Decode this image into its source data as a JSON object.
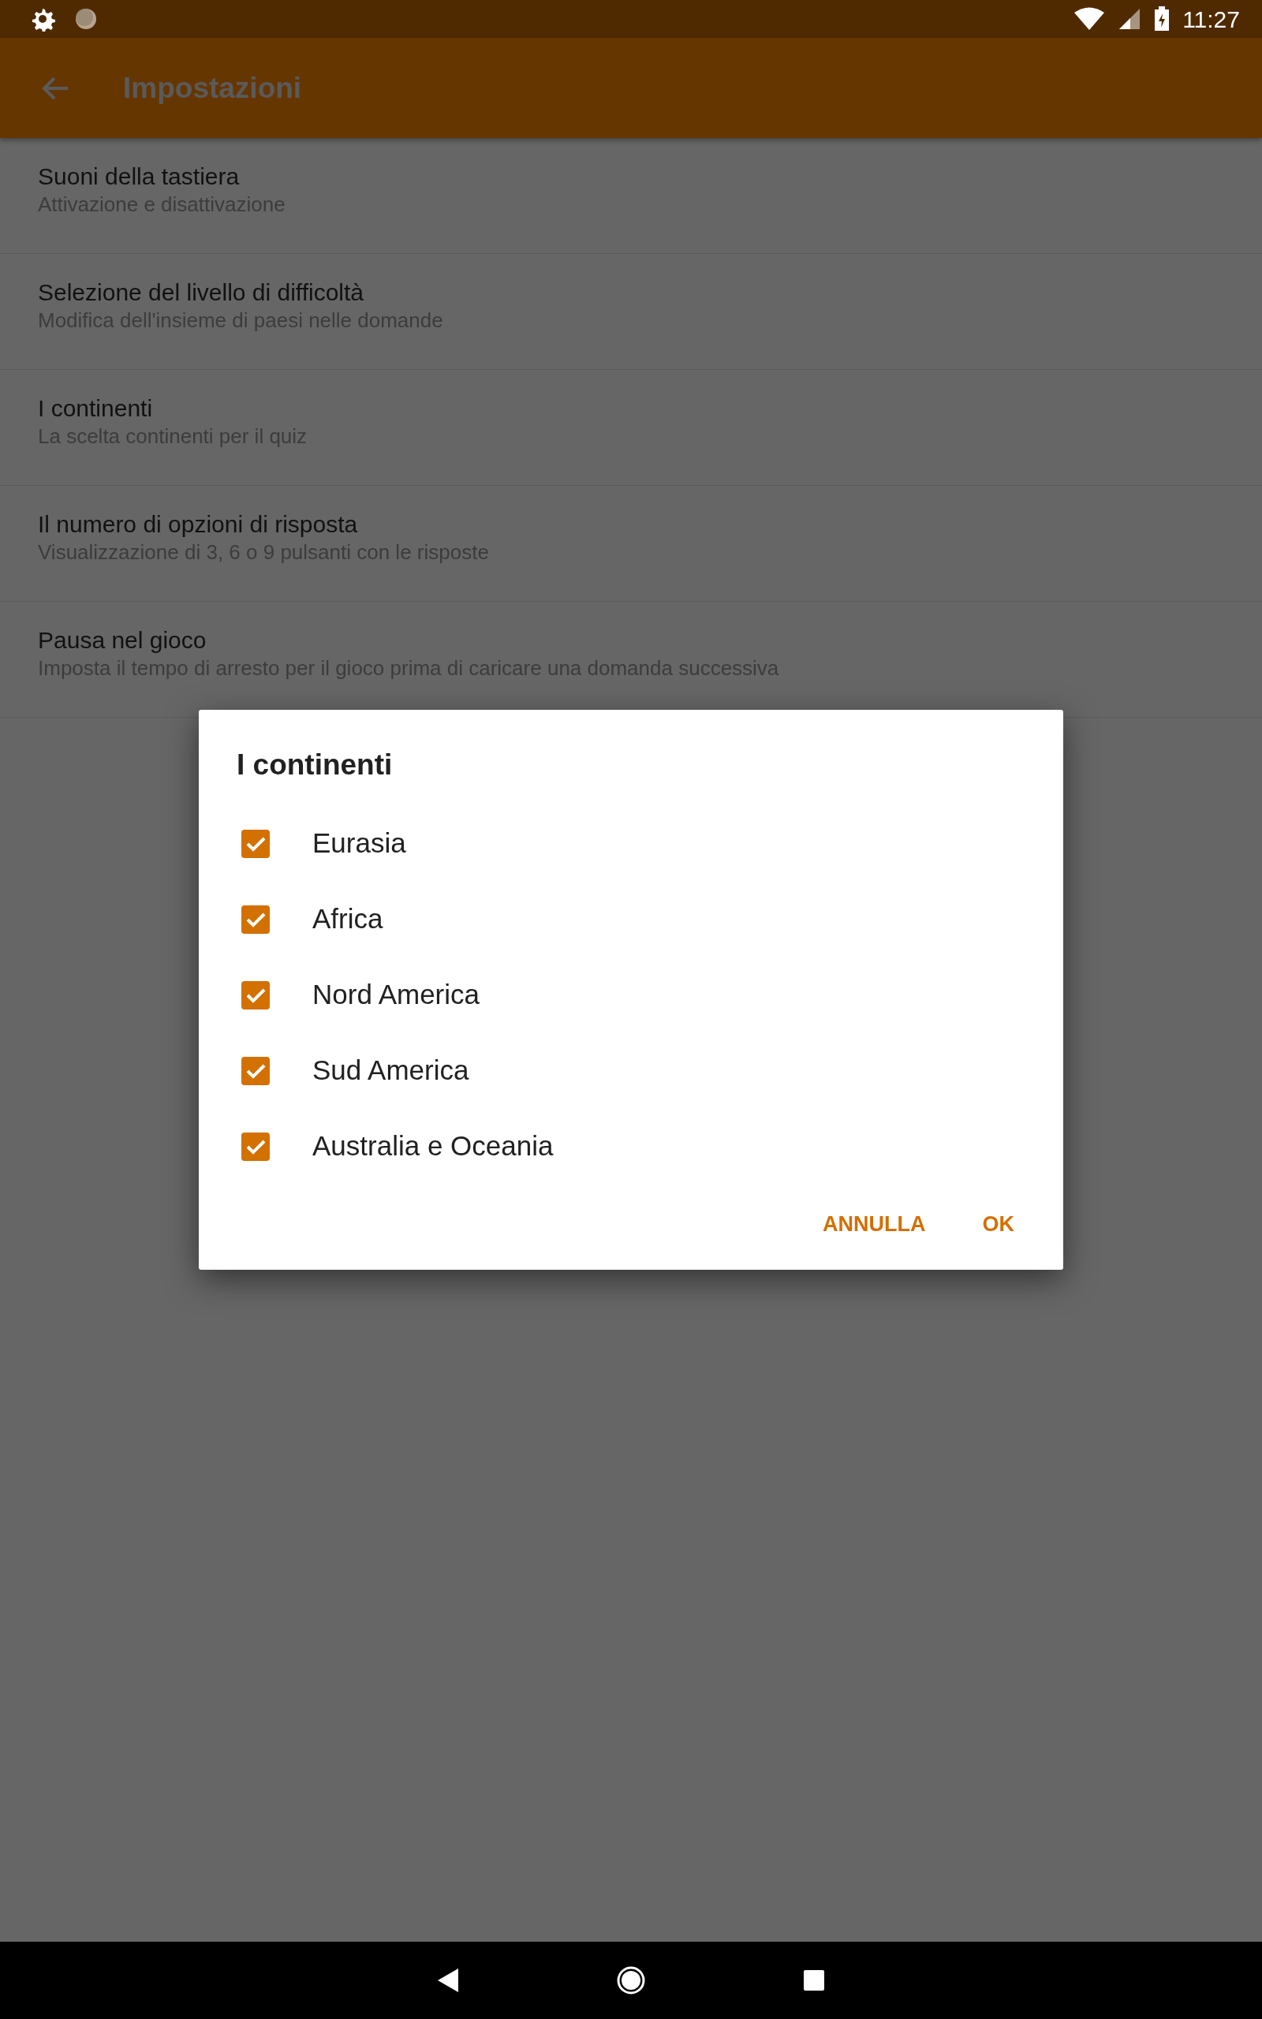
{
  "status_bar": {
    "time": "11:27"
  },
  "app_bar": {
    "title": "Impostazioni"
  },
  "settings": [
    {
      "title": "Suoni della tastiera",
      "subtitle": "Attivazione e disattivazione"
    },
    {
      "title": "Selezione del livello di difficoltà",
      "subtitle": "Modifica dell'insieme di paesi nelle domande"
    },
    {
      "title": "I continenti",
      "subtitle": "La scelta continenti per il quiz"
    },
    {
      "title": "Il numero di opzioni di risposta",
      "subtitle": "Visualizzazione di 3, 6 o 9 pulsanti con le risposte"
    },
    {
      "title": "Pausa nel gioco",
      "subtitle": "Imposta il tempo di arresto per il gioco prima di caricare una domanda successiva"
    }
  ],
  "dialog": {
    "title": "I continenti",
    "options": [
      {
        "label": "Eurasia",
        "checked": true
      },
      {
        "label": "Africa",
        "checked": true
      },
      {
        "label": "Nord America",
        "checked": true
      },
      {
        "label": "Sud America",
        "checked": true
      },
      {
        "label": "Australia e Oceania",
        "checked": true
      }
    ],
    "buttons": [
      "ANNULLA",
      "OK"
    ]
  }
}
